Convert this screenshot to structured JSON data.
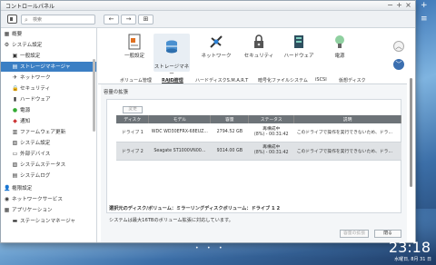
{
  "window": {
    "title": "コントロールパネル",
    "controls": [
      "−",
      "+",
      "×"
    ]
  },
  "toolbar": {
    "search_placeholder": "検索",
    "back": "←",
    "forward": "→",
    "apps": "⊞"
  },
  "sidebar": {
    "items": [
      {
        "label": "概要",
        "icon": "home-icon",
        "glyph": "▦"
      },
      {
        "label": "システム設定",
        "icon": "gear-icon",
        "glyph": "⚙"
      },
      {
        "label": "一般設定",
        "icon": "settings-icon",
        "glyph": "▣"
      },
      {
        "label": "ストレージマネージャ",
        "icon": "storage-icon",
        "glyph": "▤"
      },
      {
        "label": "ネットワーク",
        "icon": "network-icon",
        "glyph": "✈"
      },
      {
        "label": "セキュリティ",
        "icon": "lock-icon",
        "glyph": "🔒"
      },
      {
        "label": "ハードウェア",
        "icon": "hardware-icon",
        "glyph": "▮"
      },
      {
        "label": "電源",
        "icon": "power-icon",
        "glyph": "●"
      },
      {
        "label": "通知",
        "icon": "bell-icon",
        "glyph": "◆"
      },
      {
        "label": "ファームウェア更新",
        "icon": "firmware-icon",
        "glyph": "▥"
      },
      {
        "label": "システム設定",
        "icon": "system-icon",
        "glyph": "▧"
      },
      {
        "label": "外部デバイス",
        "icon": "usb-icon",
        "glyph": "▭"
      },
      {
        "label": "システムステータス",
        "icon": "status-icon",
        "glyph": "▨"
      },
      {
        "label": "システムログ",
        "icon": "log-icon",
        "glyph": "▤"
      },
      {
        "label": "権限設定",
        "icon": "user-icon",
        "glyph": "👤"
      },
      {
        "label": "ネットワークサービス",
        "icon": "globe-icon",
        "glyph": "◉"
      },
      {
        "label": "アプリケーション",
        "icon": "apps-icon",
        "glyph": "▦"
      },
      {
        "label": "ステーションマネージャ",
        "icon": "station-icon",
        "glyph": "▬"
      }
    ]
  },
  "tiles": [
    {
      "label": "一般設定",
      "icon": "general-settings-icon"
    },
    {
      "label": "ストレージマネー\nジャ",
      "icon": "storage-manager-icon"
    },
    {
      "label": "ネットワーク",
      "icon": "network-icon"
    },
    {
      "label": "セキュリティ",
      "icon": "security-icon"
    },
    {
      "label": "ハードウェア",
      "icon": "hardware-icon"
    },
    {
      "label": "電源",
      "icon": "power-icon"
    }
  ],
  "tabs": [
    "ボリューム管理",
    "RAID管理",
    "ハードディスクS.M.A.R.T",
    "暗号化ファイルシステム",
    "iSCSI",
    "仮想ディスク"
  ],
  "active_tab": 1,
  "content": {
    "title": "容量の拡張",
    "change_button": "変更",
    "columns": [
      "ディスク",
      "モデル",
      "容量",
      "ステータス",
      "説明"
    ],
    "rows": [
      {
        "disk": "ドライブ 1",
        "model": "WDC WD30EFRX-68EUZ...",
        "capacity": "2794.52 GB",
        "status1": "再構成中",
        "status2": "(8%) - 00:31:42",
        "desc": "このドライブで操作を実行できないため、ドラ..."
      },
      {
        "disk": "ドライブ 2",
        "model": "Seagate ST1000VN00...",
        "capacity": "9314.00 GB",
        "status1": "再構成中",
        "status2": "(8%) - 00:31:42",
        "desc": "このドライブで操作を実行できないため、ドラ..."
      }
    ],
    "selected_row": 1,
    "source_disk": "選択元のディスク/ボリューム：ミラーリングディスクボリューム：ドライブ 1 2",
    "limit_note": "システムは最大16TBのボリューム拡張に対応しています。",
    "expand_button": "容量の拡張",
    "close_button": "閉る"
  },
  "desktop": {
    "time": "23:18",
    "date": "水曜日, 8月 31 日",
    "strip": [
      "+",
      "≡",
      "⚙",
      "✕",
      "▦"
    ]
  }
}
